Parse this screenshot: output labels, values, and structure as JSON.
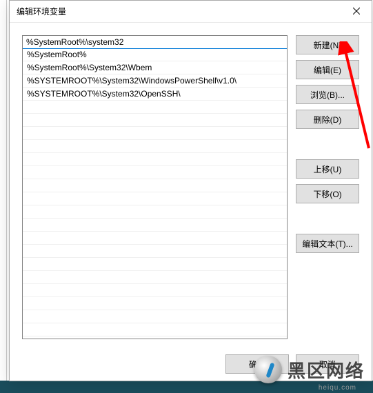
{
  "dialog": {
    "title": "编辑环境变量",
    "entries": [
      "%SystemRoot%\\system32",
      "%SystemRoot%",
      "%SystemRoot%\\System32\\Wbem",
      "%SYSTEMROOT%\\System32\\WindowsPowerShell\\v1.0\\",
      "%SYSTEMROOT%\\System32\\OpenSSH\\"
    ],
    "selected_index": 0,
    "buttons": {
      "new": "新建(N)",
      "edit": "编辑(E)",
      "browse": "浏览(B)...",
      "delete": "删除(D)",
      "move_up": "上移(U)",
      "move_down": "下移(O)",
      "edit_text": "编辑文本(T)...",
      "ok": "确定",
      "cancel": "取消"
    }
  },
  "watermark": {
    "text": "黑区网络",
    "sub": "heiqu.com"
  }
}
